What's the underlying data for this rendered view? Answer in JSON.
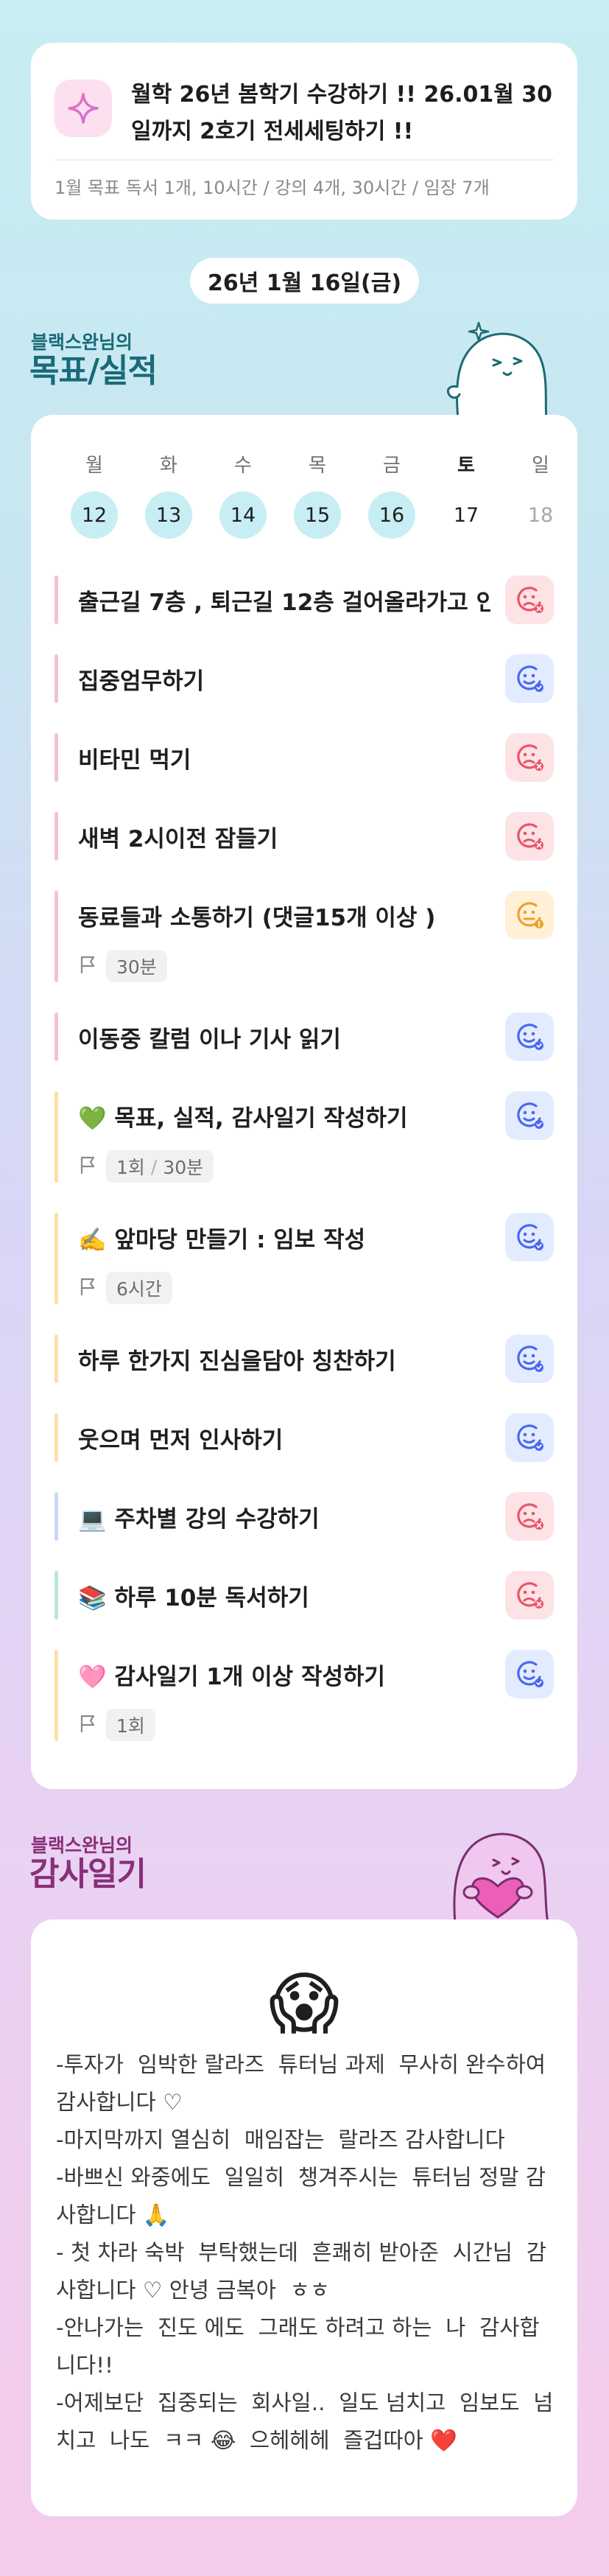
{
  "goal_banner": {
    "title": "월학 26년 봄학기 수강하기 !! 26.01월 30일까지 2호기 전세세팅하기 !!",
    "subtitle": "1월 목표  독서 1개, 10시간 / 강의 4개, 30시간 / 임장 7개",
    "icon": "sparkle-icon"
  },
  "date_label": "26년 1월 16일(금)",
  "goals_section": {
    "user_label": "블랙스완님의",
    "title": "목표/실적"
  },
  "week": {
    "days": [
      {
        "name": "월",
        "num": "12",
        "state": "done"
      },
      {
        "name": "화",
        "num": "13",
        "state": "done"
      },
      {
        "name": "수",
        "num": "14",
        "state": "done"
      },
      {
        "name": "목",
        "num": "15",
        "state": "done"
      },
      {
        "name": "금",
        "num": "16",
        "state": "done"
      },
      {
        "name": "토",
        "num": "17",
        "state": "today"
      },
      {
        "name": "일",
        "num": "18",
        "state": "future"
      }
    ]
  },
  "goals": [
    {
      "label": "출근길 7층 , 퇴근길 12층 걸어올라가고 인",
      "status": "bad",
      "bar": "#f4c0d8",
      "meta": []
    },
    {
      "label": "집중엄무하기",
      "status": "good",
      "bar": "#f4c0d8",
      "meta": []
    },
    {
      "label": "비타민 먹기",
      "status": "bad",
      "bar": "#f4c0d8",
      "meta": []
    },
    {
      "label": "새벽 2시이전 잠들기",
      "status": "bad",
      "bar": "#f4c0d8",
      "meta": []
    },
    {
      "label": "동료들과 소통하기 (댓글15개 이상 )",
      "status": "warn",
      "bar": "#f4c0d8",
      "meta": [
        "30분"
      ]
    },
    {
      "label": "이동중 칼럼 이나 기사 읽기",
      "status": "good",
      "bar": "#f4c0d8",
      "meta": []
    },
    {
      "label": "💚 목표, 실적, 감사일기 작성하기",
      "status": "good",
      "bar": "#fbe0a8",
      "meta": [
        "1회",
        "30분"
      ]
    },
    {
      "label": "✍️ 앞마당 만들기 : 임보 작성",
      "status": "good",
      "bar": "#fbe0a8",
      "meta": [
        "6시간"
      ]
    },
    {
      "label": "하루 한가지 진심을담아 칭찬하기",
      "status": "good",
      "bar": "#fbe0a8",
      "meta": []
    },
    {
      "label": "웃으며 먼저 인사하기",
      "status": "good",
      "bar": "#fbe0a8",
      "meta": []
    },
    {
      "label": "💻 주차별 강의 수강하기",
      "status": "bad",
      "bar": "#c9d8f6",
      "meta": []
    },
    {
      "label": "📚 하루 10분 독서하기",
      "status": "bad",
      "bar": "#b8e8d8",
      "meta": []
    },
    {
      "label": "🩷 감사일기 1개 이상 작성하기",
      "status": "good",
      "bar": "#fbe0a8",
      "meta": [
        "1회"
      ]
    }
  ],
  "gratitude_section": {
    "user_label": "블랙스완님의",
    "title": "감사일기"
  },
  "gratitude": {
    "emoji": "😱",
    "text": "-투자가  임박한 랄라즈  튜터님 과제  무사히 완수하여 감사합니다 ♡\n-마지막까지 열심히  매임잡는  랄라즈 감사합니다\n-바쁘신 와중에도  일일히  챙겨주시는  튜터님 정말 감사합니다 🙏\n- 첫 차라 숙박  부탁했는데  흔쾌히 받아준  시간님  감사합니다 ♡ 안녕 금복아  ㅎㅎ\n-안나가는  진도 에도  그래도 하려고 하는  나  감사합니다!!\n-어제보단  집중되는  회사일..  일도 넘치고  임보도  넘치고  나도  ㅋㅋ 😂  으헤헤헤  즐겁따아 ❤️"
  },
  "colors": {
    "goals_title": "#1a6a78",
    "gratitude_title": "#8a2f79",
    "status_good": "#4a68ef",
    "status_bad": "#ea5467",
    "status_warn": "#f0a02a"
  }
}
